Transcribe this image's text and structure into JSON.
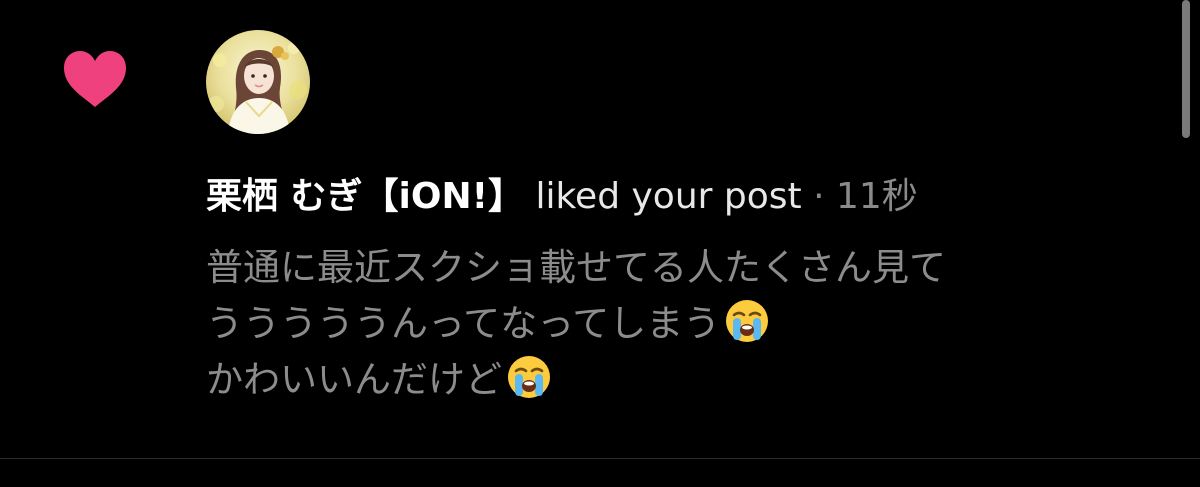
{
  "notification": {
    "author": "栗栖 むぎ【iON!】",
    "action": "liked your post",
    "separator": "·",
    "timestamp": "11秒",
    "post_lines": [
      "普通に最近スクショ載せてる人たくさん見て",
      "うううううんってなってしまう",
      "かわいいんだけど"
    ],
    "icons": {
      "like": "heart-icon",
      "avatar": "user-avatar",
      "emoji": "loudly-crying-face-emoji"
    }
  },
  "colors": {
    "background": "#000000",
    "heart": "#f0417f",
    "author": "#ffffff",
    "post_text": "#8c8c8c",
    "meta": "#8a8a8a"
  }
}
